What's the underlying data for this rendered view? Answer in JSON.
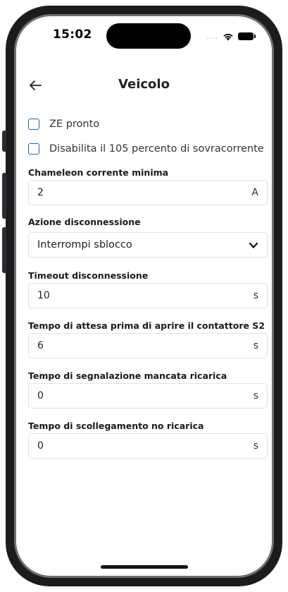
{
  "status_bar": {
    "time": "15:02",
    "signal": "....",
    "icons": [
      "wifi-icon",
      "battery-icon"
    ]
  },
  "header": {
    "title": "Veicolo",
    "back_icon": "arrow-left-icon"
  },
  "checkboxes": [
    {
      "label": "ZE pronto",
      "checked": false
    },
    {
      "label": "Disabilita il 105 percento di sovracorrente",
      "checked": false
    }
  ],
  "fields": {
    "min_current": {
      "label": "Chameleon corrente minima",
      "value": "2",
      "unit": "A"
    },
    "disconnect_action": {
      "label": "Azione disconnessione",
      "value": "Interrompi sblocco",
      "icon": "chevron-down-icon"
    },
    "disconnect_timeout": {
      "label": "Timeout disconnessione",
      "value": "10",
      "unit": "s"
    },
    "s2_wait": {
      "label": "Tempo di attesa prima di aprire il contattore S2",
      "value": "6",
      "unit": "s"
    },
    "no_charge_signal": {
      "label": "Tempo di segnalazione mancata ricarica",
      "value": "0",
      "unit": "s"
    },
    "no_charge_disconnect": {
      "label": "Tempo di scollegamento no ricarica",
      "value": "0",
      "unit": "s"
    }
  },
  "colors": {
    "checkbox_border": "#2a5ea8",
    "field_border": "#e2e2e2",
    "frame": "#1c1c1e"
  }
}
